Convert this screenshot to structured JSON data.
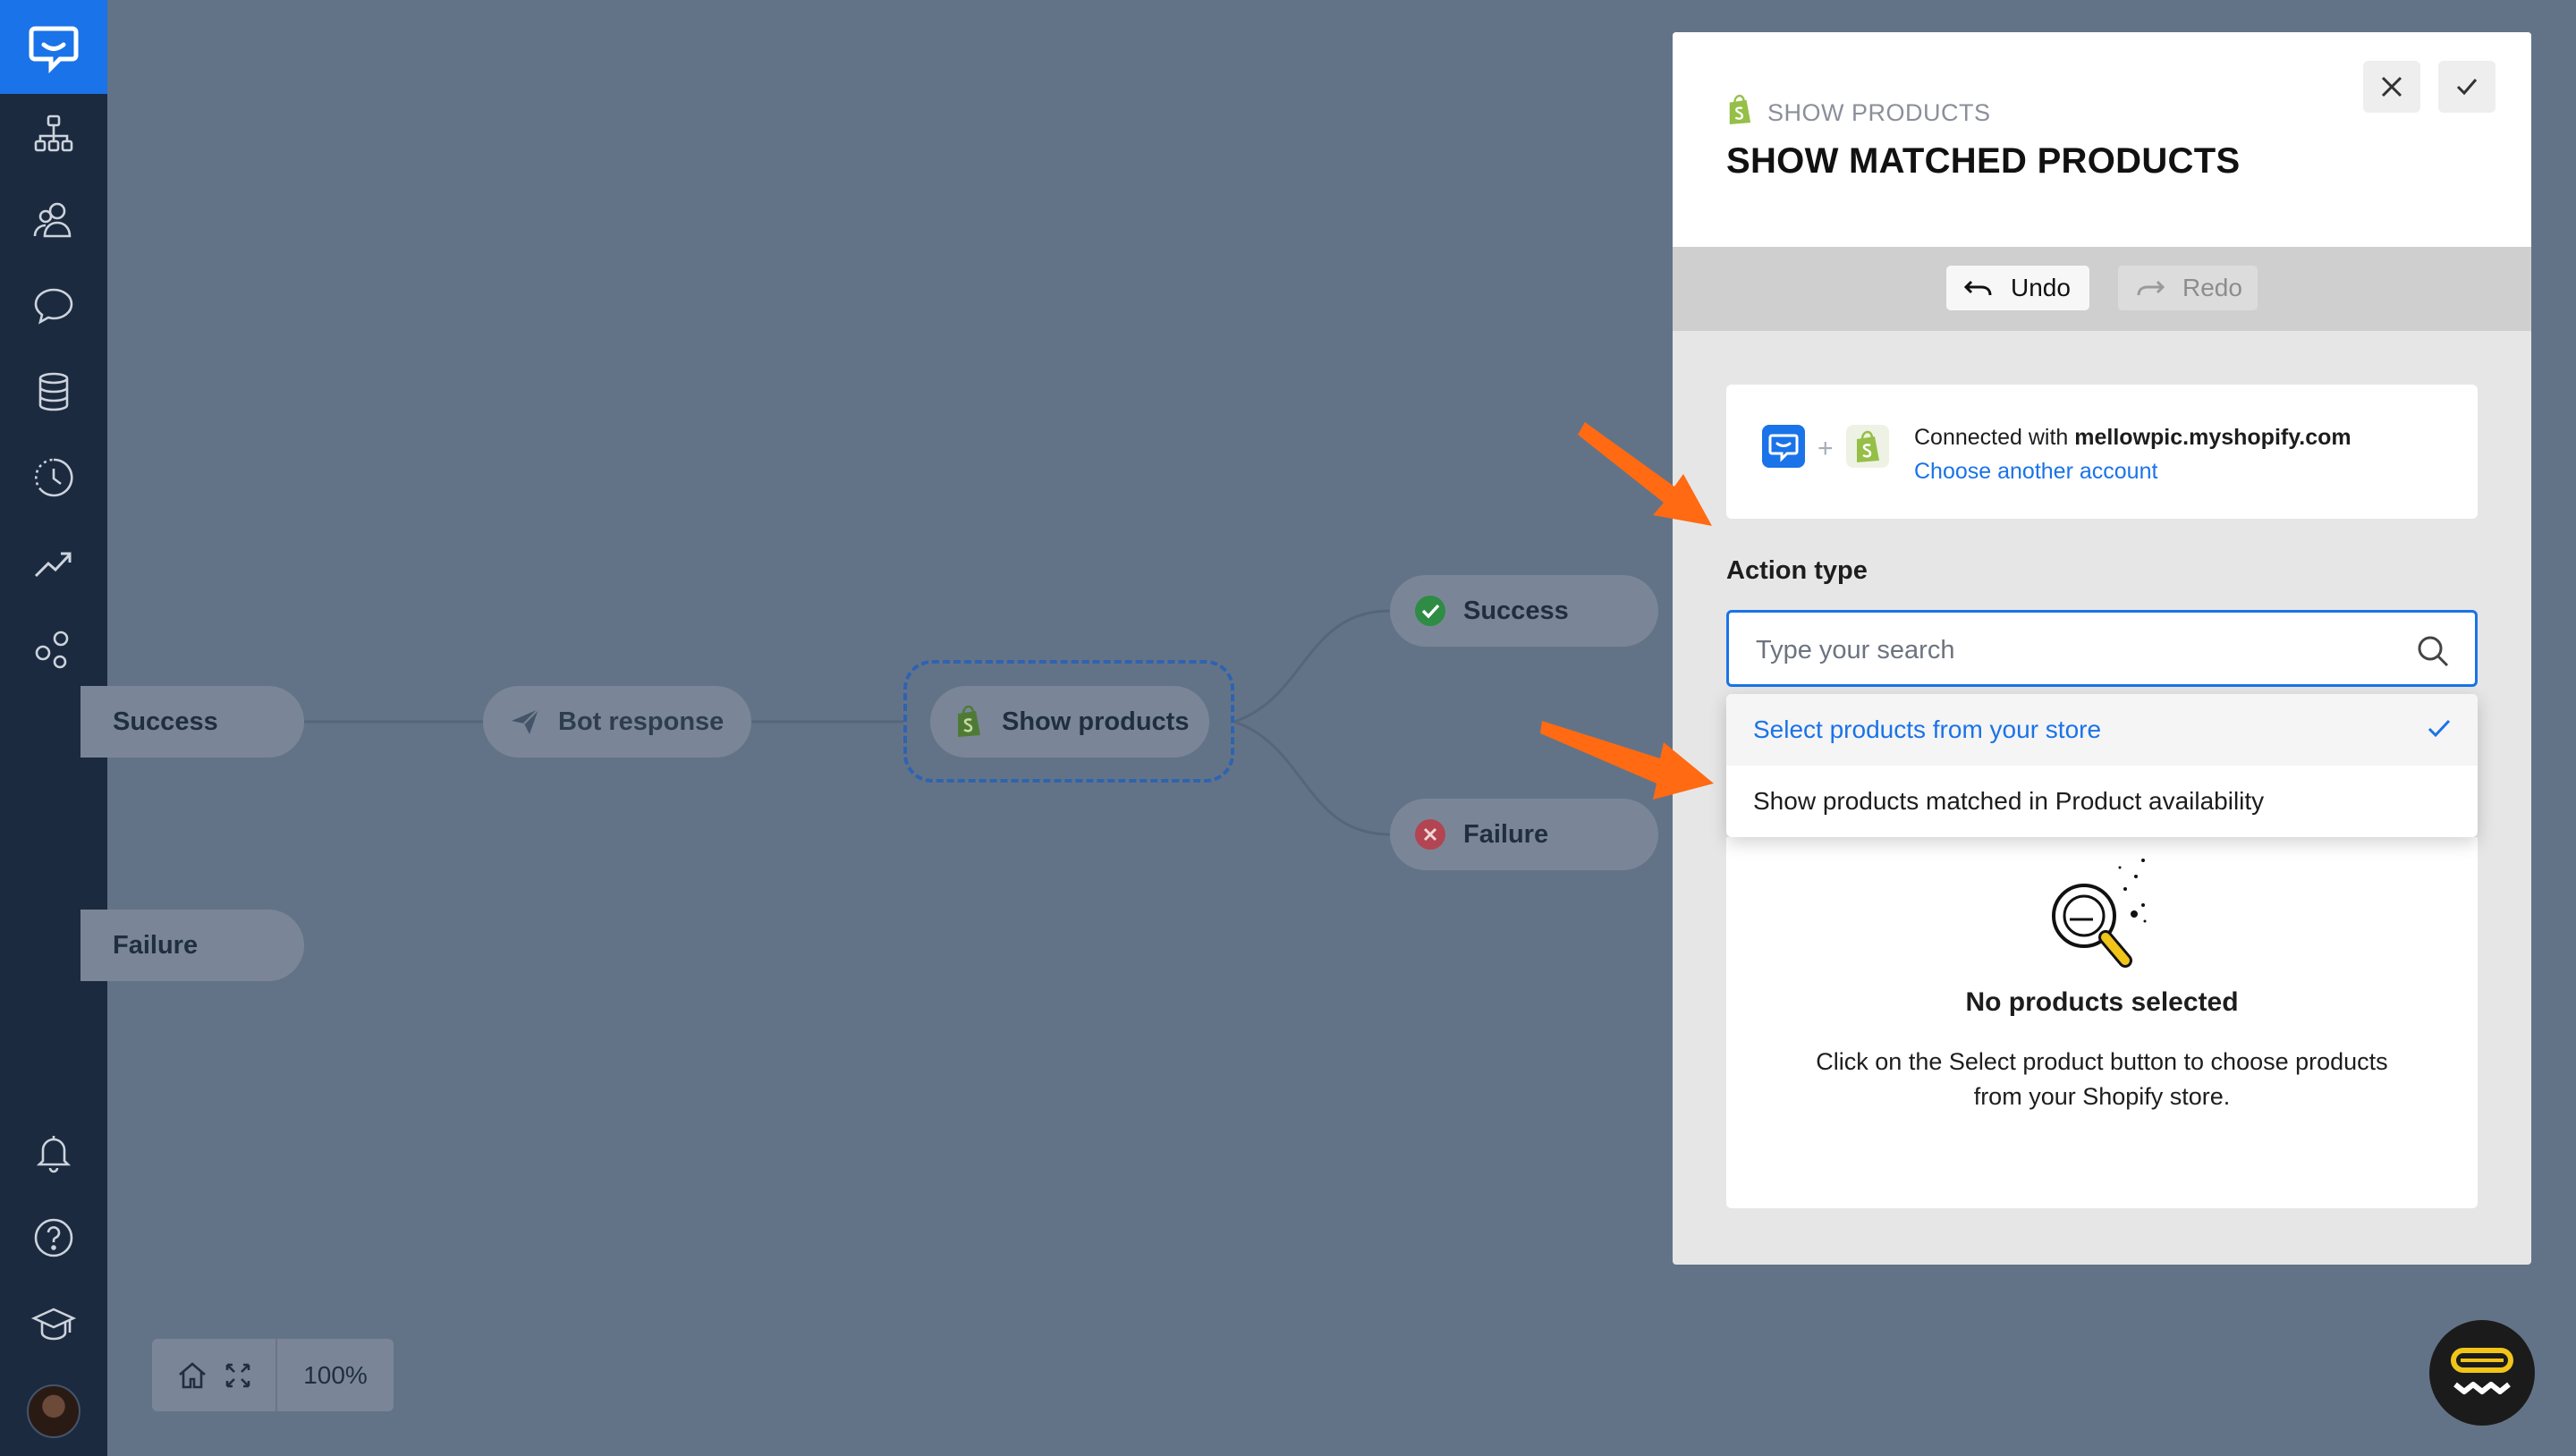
{
  "sidebar": {
    "items": [
      "logo-icon",
      "flows-icon",
      "users-icon",
      "chats-icon",
      "database-icon",
      "history-icon",
      "analytics-icon",
      "integrations-icon",
      "notifications-icon",
      "help-icon",
      "academy-icon"
    ]
  },
  "canvas": {
    "nodes": {
      "success_left": "Success",
      "failure_left": "Failure",
      "bot_response": "Bot response",
      "show_products": "Show products",
      "success_right": "Success",
      "failure_right": "Failure"
    },
    "zoom": "100%"
  },
  "panel": {
    "kicker": "SHOW PRODUCTS",
    "title": "SHOW MATCHED PRODUCTS",
    "undo": "Undo",
    "redo": "Redo",
    "connection": {
      "prefix": "Connected with ",
      "store": "mellowpic.myshopify.com",
      "link": "Choose another account"
    },
    "action_type": {
      "label": "Action type",
      "placeholder": "Type your search",
      "options": [
        "Select products from your store",
        "Show products matched in Product availability"
      ],
      "selected": "Select products from your store"
    },
    "empty": {
      "title": "No products selected",
      "description": "Click on the Select product button to choose products from your Shopify store."
    }
  },
  "colors": {
    "accent": "#1a73e8",
    "sidebar": "#1b2a3f",
    "canvas": "#637387",
    "shopify": "#95bf47",
    "arrow": "#ff6a13",
    "success": "#2e9e4a",
    "failure": "#d9434d"
  }
}
